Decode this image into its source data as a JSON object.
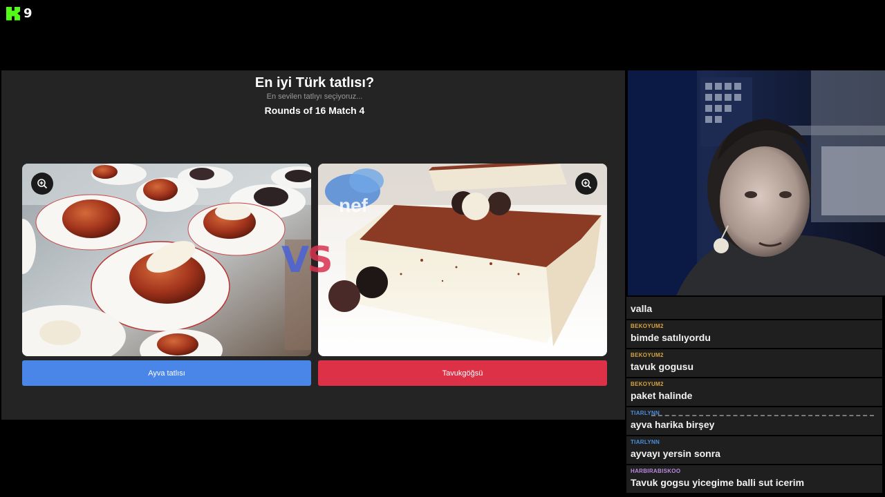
{
  "overlay": {
    "viewer_count": "9",
    "logo": "kick-logo-icon",
    "brand_color": "#53fc18"
  },
  "game": {
    "title": "En iyi Türk tatlısı?",
    "subtitle": "En sevilen tatlıyı seçiyoruz...",
    "round": "Rounds of 16 Match 4",
    "vs_v": "V",
    "vs_s": "S",
    "options": [
      {
        "label": "Ayva tatlısı",
        "color": "#4a86e8"
      },
      {
        "label": "Tavukgöğsü",
        "color": "#dc3147"
      }
    ]
  },
  "chat": {
    "messages": [
      {
        "user": "",
        "text": "valla",
        "user_color": "#d9a440"
      },
      {
        "user": "BEKOYUM2",
        "text": "bimde satılıyordu",
        "user_color": "#d9a440"
      },
      {
        "user": "BEKOYUM2",
        "text": "tavuk gogusu",
        "user_color": "#d9a440"
      },
      {
        "user": "BEKOYUM2",
        "text": "paket halinde",
        "user_color": "#d9a440"
      },
      {
        "user": "TIARLYNN",
        "text": "ayva harika birşey",
        "user_color": "#4a8fe0"
      },
      {
        "user": "TIARLYNN",
        "text": "ayvayı yersin sonra",
        "user_color": "#4a8fe0"
      },
      {
        "user": "HARBIRABISKOO",
        "text": "Tavuk gogsu yicegime balli sut icerim",
        "user_color": "#b98be0"
      }
    ]
  }
}
